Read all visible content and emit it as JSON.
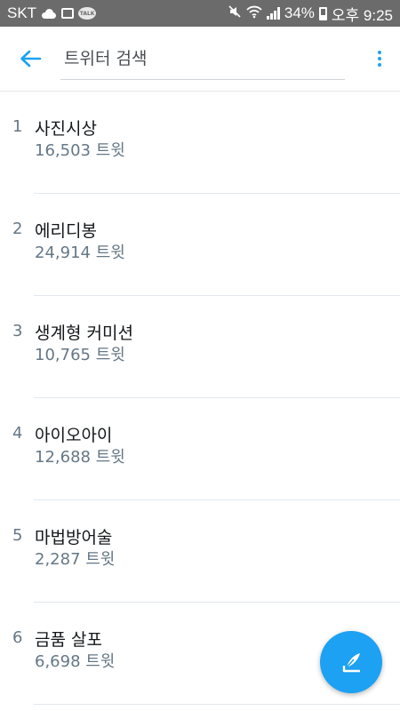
{
  "status_bar": {
    "carrier": "SKT",
    "talk_badge": "TALK",
    "battery": "34%",
    "time": "오후 9:25",
    "icons": [
      "cloud-icon",
      "gallery-icon",
      "talk-icon",
      "mute-icon",
      "wifi-icon",
      "signal-icon",
      "battery-icon"
    ]
  },
  "header": {
    "search_placeholder": "트위터 검색",
    "accent_color": "#1da1f2"
  },
  "trends": [
    {
      "rank": "1",
      "name": "사진시상",
      "count": "16,503 트윗"
    },
    {
      "rank": "2",
      "name": "에리디봉",
      "count": "24,914 트윗"
    },
    {
      "rank": "3",
      "name": "생계형 커미션",
      "count": "10,765 트윗"
    },
    {
      "rank": "4",
      "name": "아이오아이",
      "count": "12,688 트윗"
    },
    {
      "rank": "5",
      "name": "마법방어술",
      "count": "2,287 트윗"
    },
    {
      "rank": "6",
      "name": "금품 살포",
      "count": "6,698 트윗"
    }
  ]
}
